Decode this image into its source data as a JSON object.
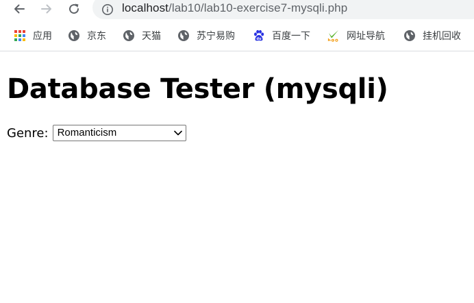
{
  "browser": {
    "url_host": "localhost",
    "url_path": "/lab10/lab10-exercise7-mysqli.php",
    "bookmarks": [
      {
        "label": "应用",
        "icon": "apps-grid-icon"
      },
      {
        "label": "京东",
        "icon": "globe-icon"
      },
      {
        "label": "天猫",
        "icon": "globe-icon"
      },
      {
        "label": "苏宁易购",
        "icon": "globe-icon"
      },
      {
        "label": "百度一下",
        "icon": "baidu-paw-icon"
      },
      {
        "label": "网址导航",
        "icon": "hao-icon"
      },
      {
        "label": "挂机回收",
        "icon": "globe-icon"
      }
    ]
  },
  "page": {
    "title": "Database Tester (mysqli)",
    "genre_label": "Genre:",
    "genre_selected": "Romanticism"
  },
  "colors": {
    "toolbar_icon": "#5f6368",
    "omnibox_bg": "#f1f3f4",
    "apps_colors": [
      "#ea4335",
      "#fbbc05",
      "#34a853",
      "#4285f4"
    ],
    "baidu_blue": "#2932e1",
    "hao_green": "#5cb531",
    "hao_orange": "#f39c12"
  }
}
